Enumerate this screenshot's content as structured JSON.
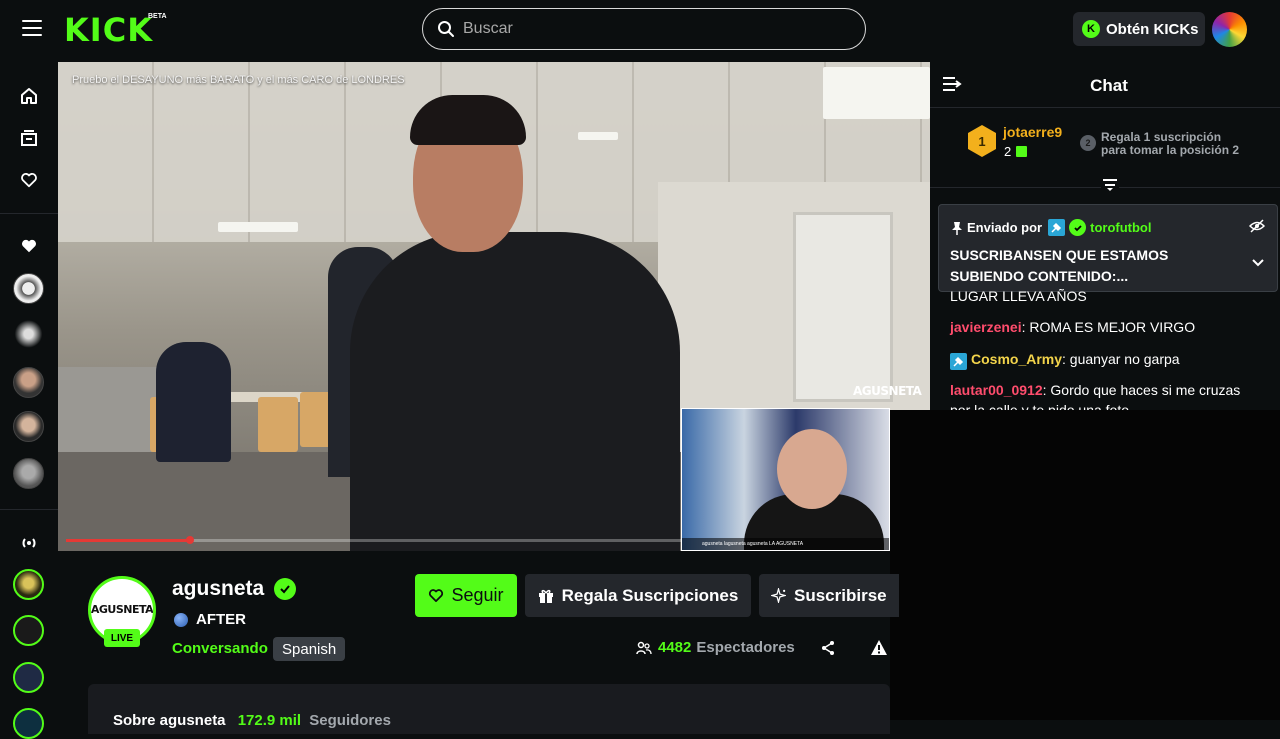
{
  "header": {
    "logo": "KICK",
    "logo_badge": "BETA",
    "search_placeholder": "Buscar",
    "get_kicks_label": "Obtén KICKs"
  },
  "player": {
    "video_title": "Pruebo el DESAYUNO más BARATO y el más CARO de LONDRES",
    "progress_fraction": 0.2,
    "overlay_brand": "AGUSNETA",
    "webcam_footer": "agusneta  lagusneta  agusneta  LA AGUSNETA"
  },
  "chat": {
    "title": "Chat",
    "leaderboard": {
      "first": {
        "rank": "1",
        "name": "jotaerre9",
        "count": "2"
      },
      "second": {
        "rank": "2",
        "line1": "Regala 1 suscripción",
        "line2": "para tomar la posición 2"
      }
    },
    "pinned": {
      "prefix": "Enviado por",
      "user": "torofutbol",
      "message": "SUSCRIBANSEN QUE ESTAMOS SUBIENDO CONTENIDO:..."
    },
    "messages": [
      {
        "user": "",
        "text": "LUGAR LLEVA AÑOS",
        "color": "#ffffff"
      },
      {
        "user": "javierzenei",
        "text": ": ROMA ES MEJOR VIRGO",
        "color": "#ff4d6d"
      },
      {
        "user": "Cosmo_Army",
        "text": ": guanyar no garpa",
        "color": "#f3d44b"
      },
      {
        "user": "lautar00_0912",
        "text": ": Gordo que haces si me cruzas por la calle y te pido una foto",
        "color": "#ff4d6d"
      }
    ]
  },
  "channel": {
    "avatar_text": "AGUSNETA",
    "live_label": "LIVE",
    "name": "agusneta",
    "stream_title": "AFTER",
    "category": "Conversando",
    "language": "Spanish",
    "follow_label": "Seguir",
    "gift_label": "Regala Suscripciones",
    "subscribe_label": "Suscribirse",
    "viewer_count": "4482",
    "viewer_label": "Espectadores",
    "about_label": "Sobre agusneta",
    "followers_count": "172.9 mil",
    "followers_label": "Seguidores"
  },
  "colors": {
    "accent": "#53fc18",
    "background": "#0b0e0f",
    "surface": "#24272c"
  }
}
